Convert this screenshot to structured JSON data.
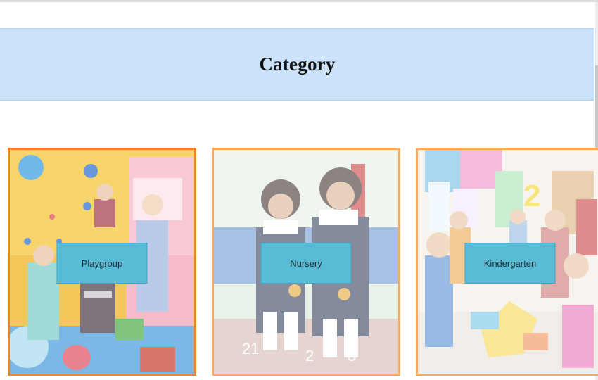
{
  "page": {
    "heading": "Category"
  },
  "categories": [
    {
      "label": "Playgroup"
    },
    {
      "label": "Nursery"
    },
    {
      "label": "Kindergarten"
    }
  ],
  "colors": {
    "banner_bg": "#cae3fb",
    "card_border_active": "#f58220",
    "card_border": "#f7a960",
    "button_bg": "#59bcd6"
  }
}
